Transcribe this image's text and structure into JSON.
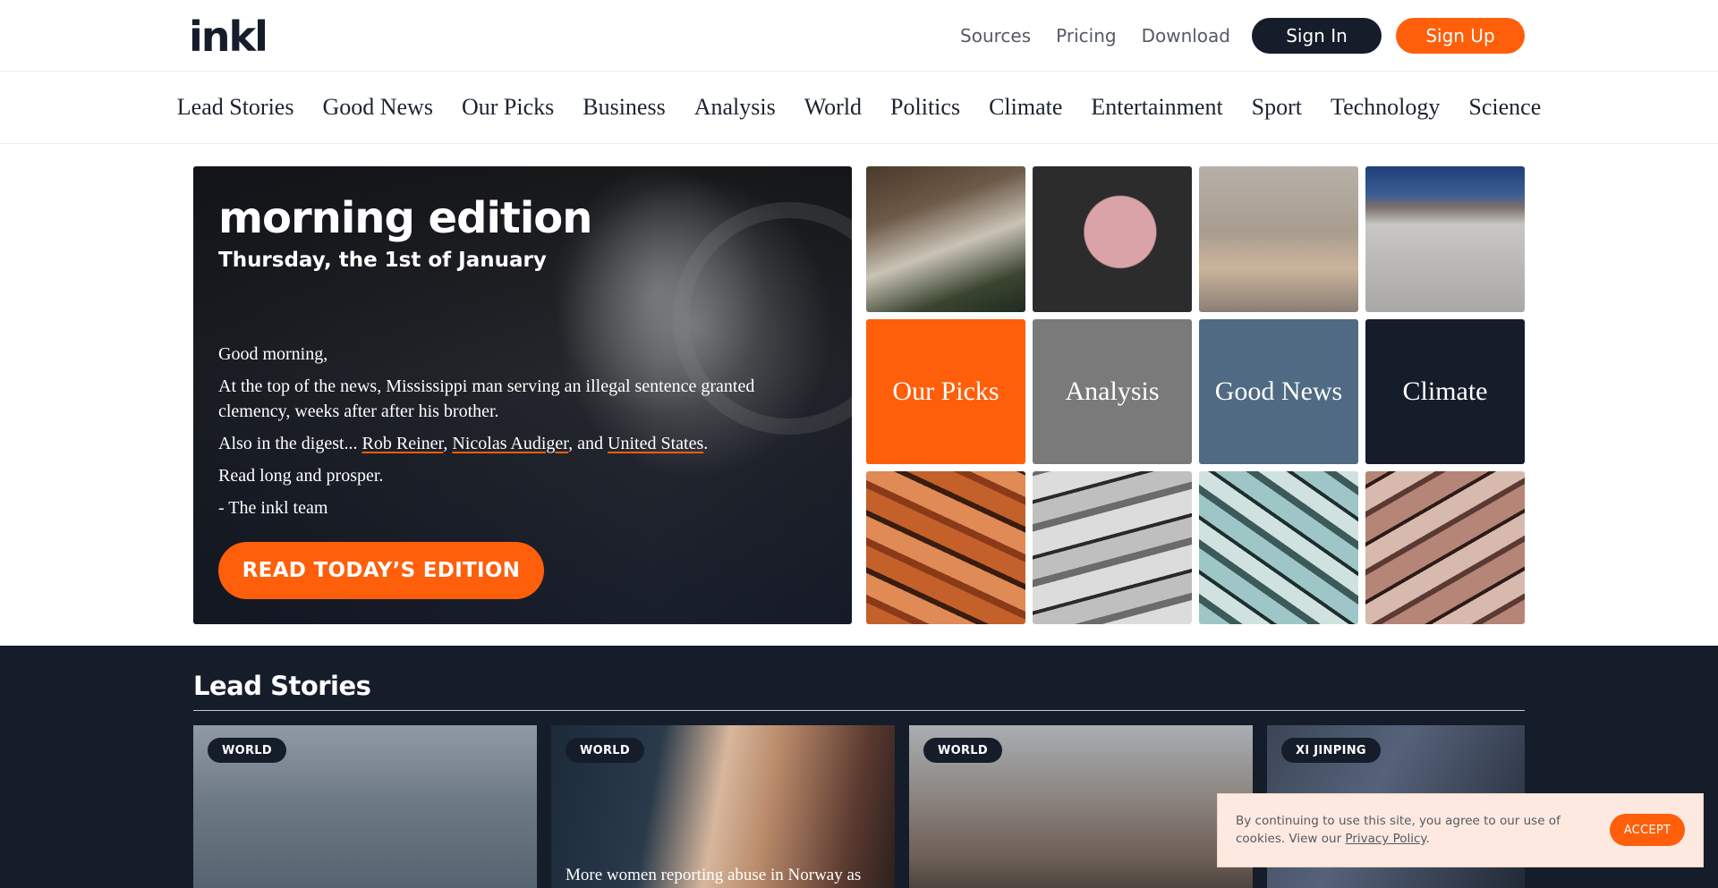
{
  "header": {
    "logo_text": "inkl",
    "nav": [
      "Sources",
      "Pricing",
      "Download"
    ],
    "signin_label": "Sign In",
    "signup_label": "Sign Up",
    "colors": {
      "brand_orange": "#ff5f0b",
      "navy": "#151c2a"
    }
  },
  "categories": [
    "Lead Stories",
    "Good News",
    "Our Picks",
    "Business",
    "Analysis",
    "World",
    "Politics",
    "Climate",
    "Entertainment",
    "Sport",
    "Technology",
    "Science"
  ],
  "hero": {
    "title": "morning edition",
    "date": "Thursday, the 1st of January",
    "greeting": "Good morning,",
    "top_news": "At the top of the news, Mississippi man serving an illegal sentence granted clemency, weeks after after his brother.",
    "digest_prefix": "Also in the digest...",
    "digest_links": [
      "Rob Reiner",
      "Nicolas Audiger",
      "United States"
    ],
    "digest_and": "and",
    "closing": "Read long and prosper.",
    "signoff": "- The inkl team",
    "cta": "READ TODAY’S EDITION"
  },
  "tiles": {
    "labels": [
      "Our Picks",
      "Analysis",
      "Good News",
      "Climate"
    ],
    "colors": [
      "#ff5f0b",
      "#7a7a7a",
      "#4f6a82",
      "#151c2a"
    ]
  },
  "lead": {
    "title": "Lead Stories",
    "cards": [
      {
        "badge": "WORLD",
        "headline": ""
      },
      {
        "badge": "WORLD",
        "headline": "More women reporting abuse in Norway as"
      },
      {
        "badge": "WORLD",
        "headline": ""
      },
      {
        "badge": "XI JINPING",
        "headline": ""
      }
    ]
  },
  "cookie": {
    "text": "By continuing to use this site, you agree to our use of cookies. View our",
    "link": "Privacy Policy",
    "accept": "ACCEPT"
  }
}
